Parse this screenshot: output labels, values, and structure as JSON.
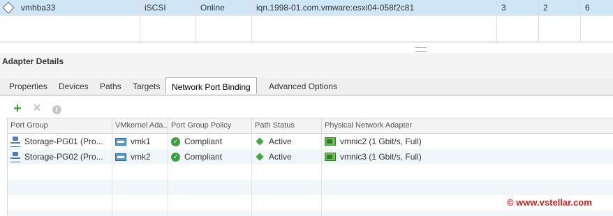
{
  "adapter_table": {
    "selected_row": {
      "adapter": "vmhba33",
      "type": "iSCSI",
      "status": "Online",
      "identifier": "iqn.1998-01.com.vmware:esxi04-058f2c81",
      "targets": "3",
      "devices": "2",
      "paths": "6"
    }
  },
  "details": {
    "title": "Adapter Details",
    "tabs": [
      "Properties",
      "Devices",
      "Paths",
      "Targets",
      "Network Port Binding",
      "Advanced Options"
    ],
    "active_tab": "Network Port Binding"
  },
  "toolbar": {
    "add_icon": "plus-icon",
    "remove_icon": "x-icon",
    "info_icon": "info-icon"
  },
  "binding_grid": {
    "columns": [
      "Port Group",
      "VMkernel Ada...",
      "Port Group Policy",
      "Path Status",
      "Physical Network Adapter"
    ],
    "rows": [
      {
        "port_group": "Storage-PG01 (Pro...",
        "vmkernel": "vmk1",
        "policy": "Compliant",
        "path_status": "Active",
        "physical_adapter": "vmnic2 (1 Gbit/s, Full)"
      },
      {
        "port_group": "Storage-PG02 (Pro...",
        "vmkernel": "vmk2",
        "policy": "Compliant",
        "path_status": "Active",
        "physical_adapter": "vmnic3 (1 Gbit/s, Full)"
      }
    ]
  },
  "watermark": "© www.vstellar.com",
  "colors": {
    "selection": "#cfe6f7",
    "ok_green": "#3c9e3c",
    "watermark_red": "#d61f1f"
  }
}
